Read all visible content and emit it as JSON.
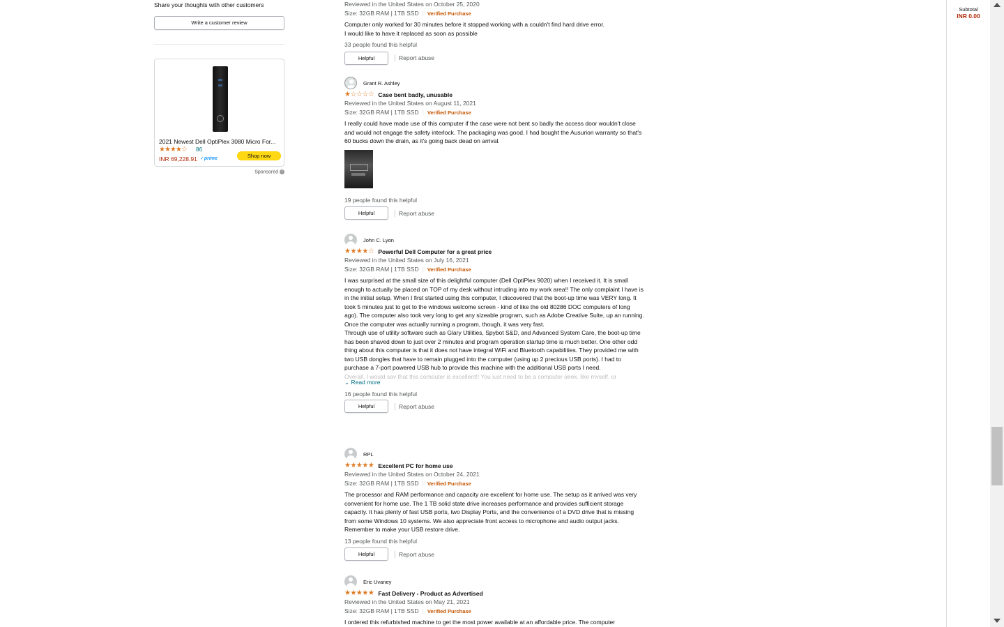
{
  "left": {
    "share_text": "Share your thoughts with other customers",
    "write_review": "Write a customer review",
    "ad": {
      "title": "2021 Newest Dell OptiPlex 3080 Micro For...",
      "stars": "★★★★☆",
      "count": "86",
      "price": "INR 69,228.91",
      "prime": "✓prime",
      "shop_now": "Shop now",
      "sponsored": "Sponsored"
    }
  },
  "sidebar": {
    "subtotal_label": "Subtotal",
    "subtotal_value": "INR 0.00"
  },
  "reviews": [
    {
      "date": "Reviewed in the United States on October 25, 2020",
      "size": "Size: 32GB RAM | 1TB SSD",
      "verified": "Verified Purchase",
      "body": [
        "Computer only worked for 30 minutes before it stopped working with a couldn't find hard drive error.",
        "I would like to have it replaced as soon as possible"
      ],
      "helpful_count": "33 people found this helpful",
      "helpful": "Helpful",
      "report": "Report abuse"
    },
    {
      "name": "Grant R. Ashley",
      "rating": 1,
      "stars": "★☆☆☆☆",
      "title": "Case bent badly, unusable",
      "date": "Reviewed in the United States on August 11, 2021",
      "size": "Size: 32GB RAM | 1TB SSD",
      "verified": "Verified Purchase",
      "body": [
        "I really could have made use of this computer if the case were not bent so badly the access door wouldn't close and would not engage the safety interlock. The packaging was good. I had bought the Ausurion warranty so that's 60 bucks down the drain, as it's going back dead on arrival."
      ],
      "helpful_count": "19 people found this helpful",
      "helpful": "Helpful",
      "report": "Report abuse"
    },
    {
      "name": "John C. Lyon",
      "rating": 4,
      "stars": "★★★★☆",
      "title": "Powerful Dell Computer for a great price",
      "date": "Reviewed in the United States on July 16, 2021",
      "size": "Size: 32GB RAM | 1TB SSD",
      "verified": "Verified Purchase",
      "body": [
        "I was surprised at the small size of this delightful computer (Dell OptiPlex 9020) when I received it. It is small enough to actually be placed on TOP of my desk without intruding into my work area!! The only complaint I have is in the initial setup. When I first started using this computer, I discovered that the boot-up time was VERY long. It took 5 minutes just to get to the windows welcome screen - kind of like the old 80286 DOC computers of long ago). The computer also took very long to get any sizeable program, such as Adobe Creative Suite, up an running. Once the computer was actually running a program, though, it was very fast.",
        "Through use of utility software such as Glary Utilities, Spybot S&D, and Advanced System Care, the boot-up time has been shaved down to just over 2 minutes and program operation startup time is much better. One other odd thing about this computer is that it does not have integral WiFi and Bluetooth capabilities. They provided me with two USB dongles that have to remain plugged into the computer (using up 2 precious USB ports). I had to purchase a 7-port powered USB hub to provide this machine with the additional USB ports I need."
      ],
      "fade": "Overall, I would say that this computer is excellent!! You just need to be a computer geek, like myself, or",
      "read_more": "Read more",
      "helpful_count": "16 people found this helpful",
      "helpful": "Helpful",
      "report": "Report abuse"
    },
    {
      "name": "RPL",
      "rating": 5,
      "stars": "★★★★★",
      "title": "Excellent PC for home use",
      "date": "Reviewed in the United States on October 24, 2021",
      "size": "Size: 32GB RAM | 1TB SSD",
      "verified": "Verified Purchase",
      "body": [
        "The processor and RAM performance and capacity are excellent for home use. The setup as it arrived was very convenient for home use. The 1 TB solid state drive increases performance and provides sufficient storage capacity. It has plenty of fast USB ports, two Display Ports, and the convenience of a DVD drive that is missing from some Windows 10 systems. We also appreciate front access to microphone and audio output jacks. Remember to make your USB restore drive."
      ],
      "helpful_count": "13 people found this helpful",
      "helpful": "Helpful",
      "report": "Report abuse"
    },
    {
      "name": "Eric Uvaney",
      "rating": 5,
      "stars": "★★★★★",
      "title": "Fast Delivery - Product as Advertised",
      "date": "Reviewed in the United States on May 21, 2021",
      "size": "Size: 32GB RAM | 1TB SSD",
      "verified": "Verified Purchase",
      "body": [
        "I ordered this refurbished machine to get the most power available at an affordable price. The computer"
      ]
    }
  ]
}
